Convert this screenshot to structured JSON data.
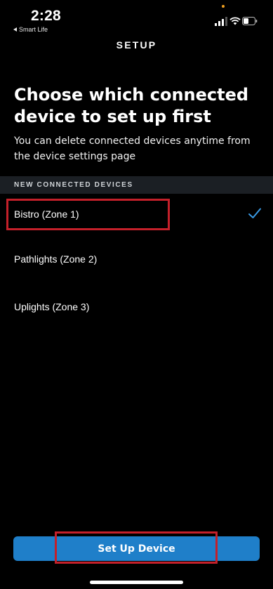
{
  "status_bar": {
    "time": "2:28",
    "back_app_label": "Smart Life"
  },
  "header": {
    "title": "SETUP"
  },
  "main": {
    "heading": "Choose which connected device to set up first",
    "subtext": "You can delete connected devices anytime from the device settings page",
    "section_label": "NEW CONNECTED DEVICES",
    "devices": [
      {
        "label": "Bistro (Zone 1)",
        "selected": true
      },
      {
        "label": "Pathlights (Zone 2)",
        "selected": false
      },
      {
        "label": "Uplights (Zone 3)",
        "selected": false
      }
    ]
  },
  "footer": {
    "button_label": "Set Up Device"
  },
  "colors": {
    "background": "#000000",
    "accent_blue": "#1f7fc9",
    "check_blue": "#3a9be6",
    "highlight_red": "#c4202a",
    "section_bg": "#1b1f24"
  },
  "icons": [
    "back-triangle-icon",
    "signal-icon",
    "wifi-icon",
    "battery-icon",
    "checkmark-icon"
  ]
}
